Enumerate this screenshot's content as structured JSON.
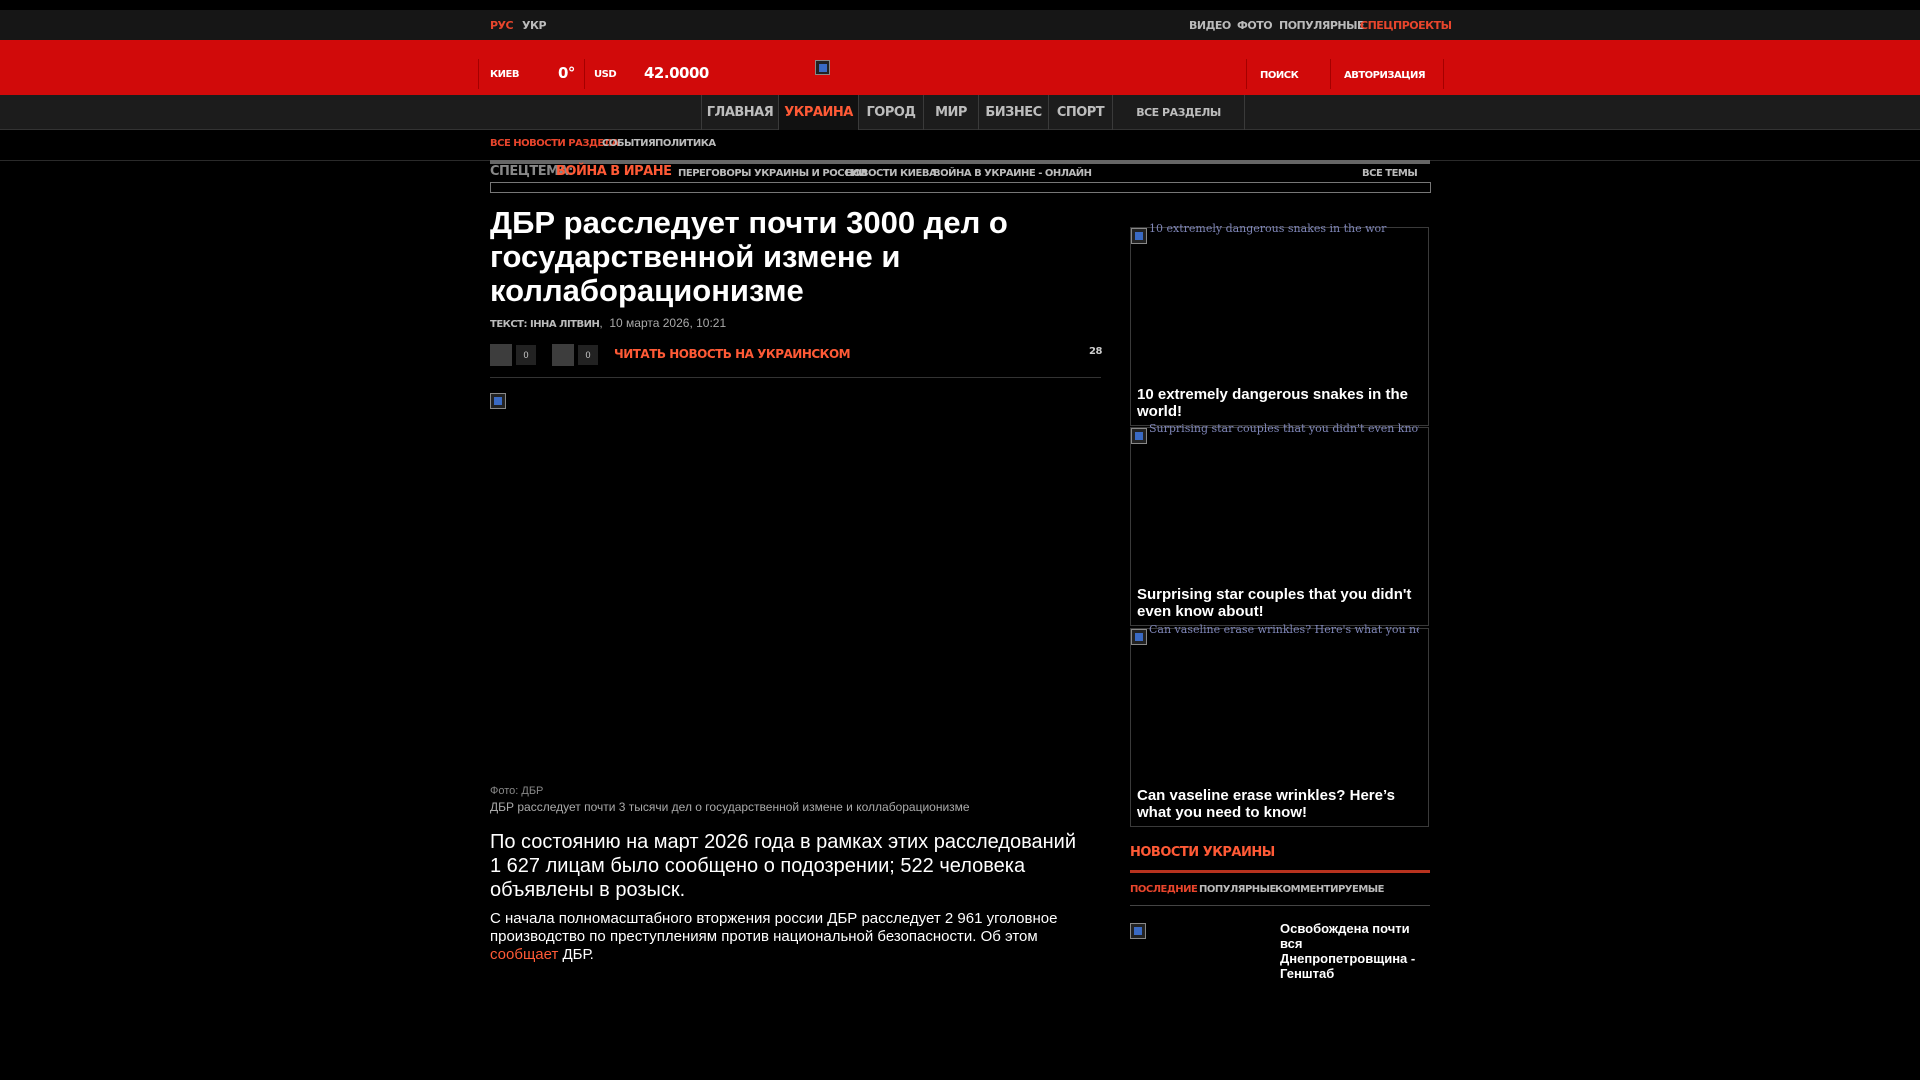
{
  "topbar": {
    "lang_ru": "РУС",
    "lang_ua": "УКР",
    "links": [
      "ВИДЕО",
      "ФОТО",
      "ПОПУЛЯРНЫЕ",
      "СПЕЦПРОЕКТЫ"
    ]
  },
  "header": {
    "city": "КИЕВ",
    "temperature": "0°",
    "currency": "USD",
    "rate": "42.0000",
    "search": "ПОИСК",
    "login": "АВТОРИЗАЦИЯ"
  },
  "nav": {
    "tabs": [
      "ГЛАВНАЯ",
      "УКРАИНА",
      "ГОРОД",
      "МИР",
      "БИЗНЕС",
      "СПОРТ"
    ],
    "active": "УКРАИНА",
    "all_sections": "ВСЕ РАЗДЕЛЫ"
  },
  "subnav": {
    "items": [
      "ВСЕ НОВОСТИ РАЗДЕЛА",
      "СОБЫТИЯ",
      "ПОЛИТИКА"
    ]
  },
  "special_topic": {
    "label": "СПЕЦТЕМА:",
    "topic": "ВОЙНА В ИРАНЕ",
    "links": [
      "ПЕРЕГОВОРЫ УКРАИНЫ И РОССИИ",
      "НОВОСТИ КИЕВА",
      "ВОЙНА В УКРАИНЕ - ОНЛАЙН"
    ],
    "all": "ВСЕ ТЕМЫ"
  },
  "article": {
    "title": "ДБР расследует почти 3000 дел о государственной измене и коллаборационизме",
    "byline_prefix": "ТЕКСТ: ІННА ЛІТВИН",
    "date": "10 марта 2026, 10:21",
    "likes": "0",
    "shares": "0",
    "read_ua": "ЧИТАТЬ НОВОСТЬ НА УКРАИНСКОМ",
    "views": "28",
    "photo_credit": "Фото: ДБР",
    "photo_caption": "ДБР расследует почти 3 тысячи дел о государственной измене и коллаборационизме",
    "lead": "По состоянию на март 2026 года в рамках этих расследований 1 627 лицам было сообщено о подозрении; 522 человека объявлены в розыск.",
    "body_text": "С начала полномасштабного вторжения россии ДБР расследует 2 961 уголовное производство по преступлениям против национальной безопасности. Об этом ",
    "body_link": "сообщает",
    "body_end": " ДБР."
  },
  "sidebar": {
    "cards": [
      {
        "alt": "10 extremely dangerous snakes in the wor",
        "title": "10 extremely dangerous snakes in the world!"
      },
      {
        "alt": "Surprising star couples that you didn't even know about!",
        "title": "Surprising star couples that you didn't even know about!"
      },
      {
        "alt": "Can vaseline erase wrinkles? Here's what you need to know!",
        "title": "Can vaseline erase wrinkles? Here’s what you need to know!"
      }
    ],
    "news_heading": "НОВОСТИ УКРАИНЫ",
    "tabs": [
      "ПОСЛЕДНИЕ",
      "ПОПУЛЯРНЫЕ",
      "КОММЕНТИРУЕМЫЕ"
    ],
    "news_items": [
      {
        "title": "Освобождена почти вся Днепропетровщина - Генштаб"
      }
    ]
  },
  "colors": {
    "brand_red": "#d10a0a",
    "accent": "#ff5a36",
    "background": "#000000"
  }
}
